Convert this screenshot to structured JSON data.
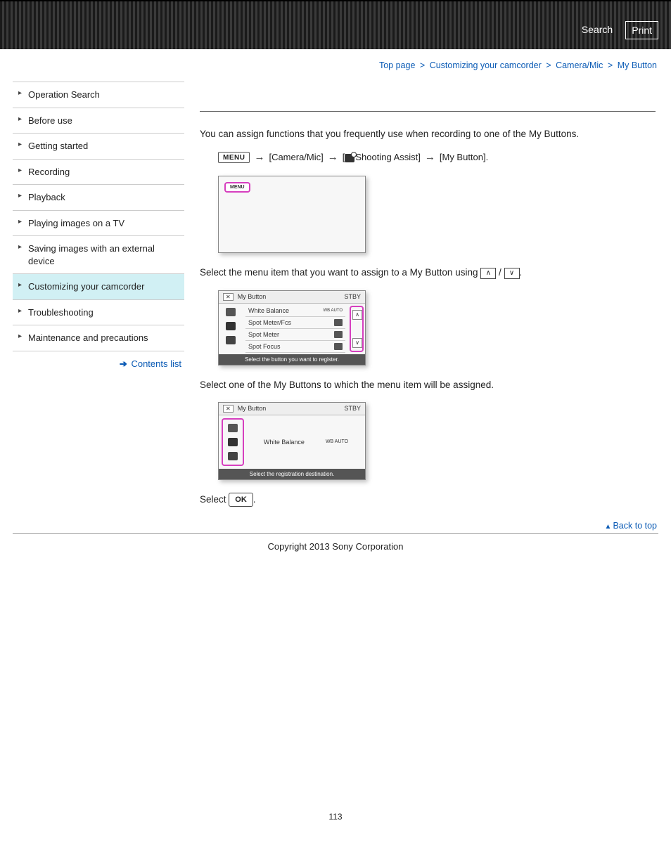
{
  "topbar": {
    "search": "Search",
    "print": "Print"
  },
  "breadcrumb": {
    "items": [
      "Top page",
      "Customizing your camcorder",
      "Camera/Mic",
      "My Button"
    ],
    "sep": ">"
  },
  "sidebar": {
    "items": [
      "Operation Search",
      "Before use",
      "Getting started",
      "Recording",
      "Playback",
      "Playing images on a TV",
      "Saving images with an external device",
      "Customizing your camcorder",
      "Troubleshooting",
      "Maintenance and precautions"
    ],
    "active_index": 7,
    "contents_link": "Contents list"
  },
  "content": {
    "intro": "You can assign functions that you frequently use when recording to one of the My Buttons.",
    "menu_label": "MENU",
    "step_path": {
      "a": "[Camera/Mic]",
      "b_prefix": "[",
      "b_text": "Shooting Assist]",
      "c": "[My Button]."
    },
    "shot1_menu": "MENU",
    "para_select_item_prefix": "Select the menu item that you want to assign to a My Button using ",
    "para_select_item_sep": " / ",
    "para_select_item_suffix": ".",
    "shot2": {
      "title": "My Button",
      "status": "STBY",
      "rows": [
        "White Balance",
        "Spot Meter/Fcs",
        "Spot Meter",
        "Spot Focus"
      ],
      "row0_badge": "WB\nAUTO",
      "footer": "Select the button you want to register."
    },
    "para_select_button": "Select one of the My Buttons to which the menu item will be assigned.",
    "shot3": {
      "title": "My Button",
      "status": "STBY",
      "item": "White Balance",
      "badge": "WB\nAUTO",
      "footer": "Select the registration destination."
    },
    "select_ok_prefix": "Select ",
    "ok_label": "OK",
    "select_ok_suffix": "."
  },
  "footer": {
    "back_to_top": "Back to top",
    "copyright": "Copyright 2013 Sony Corporation",
    "page_number": "113"
  }
}
